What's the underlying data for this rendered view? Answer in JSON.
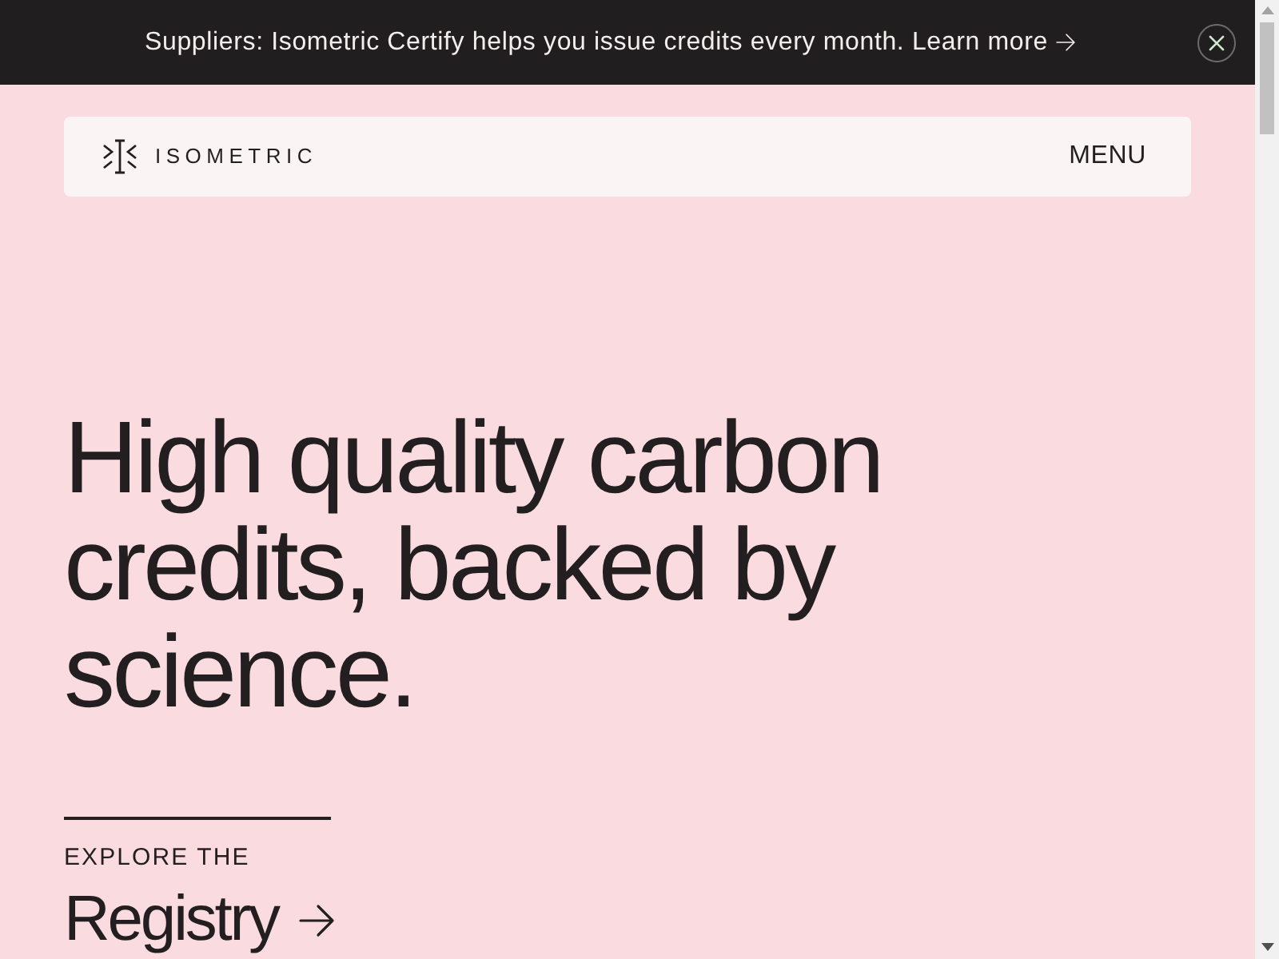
{
  "banner": {
    "text": "Suppliers: Isometric Certify helps you issue credits every month.",
    "link": "Learn more"
  },
  "nav": {
    "logo": "ISOMETRIC",
    "menu": "MENU"
  },
  "hero": {
    "heading": "High quality carbon credits, backed by science."
  },
  "explore": {
    "kicker": "EXPLORE THE",
    "link": "Registry"
  }
}
